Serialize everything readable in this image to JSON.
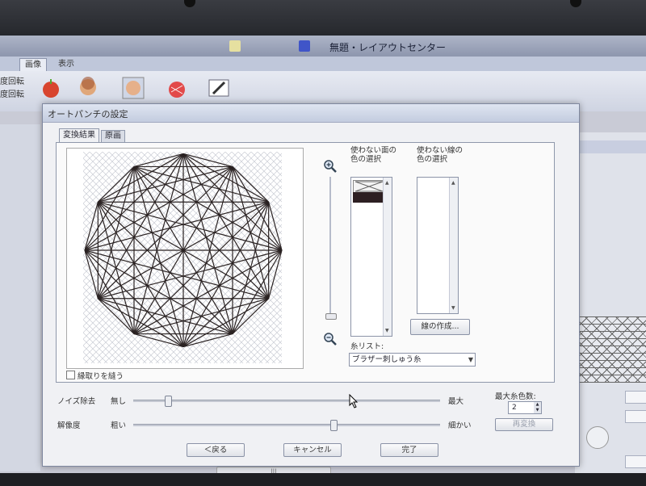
{
  "window": {
    "title": "無題・レイアウトセンター"
  },
  "ribbon": {
    "tabs": [
      "画像",
      "表示"
    ],
    "left_labels": [
      "度回転",
      "度回転"
    ],
    "icons": [
      "apple-icon",
      "child-photo-icon",
      "girl-photo-icon",
      "strawberry-icon",
      "pen-edit-icon"
    ]
  },
  "dialog": {
    "title": "オートパンチの設定",
    "tabs": [
      "変換結果",
      "原画"
    ],
    "unused_face_color_label": "使わない面の\n色の選択",
    "unused_line_color_label": "使わない線の\n色の選択",
    "make_line_button": "線の作成...",
    "thread_list_label": "糸リスト:",
    "thread_list_value": "ブラザー刺しゅう糸",
    "border_checkbox_label": "縁取りを縫う",
    "noise": {
      "label": "ノイズ除去",
      "min_label": "無し",
      "max_label": "最大",
      "value_fraction": 0.11
    },
    "resolution": {
      "label": "解像度",
      "min_label": "粗い",
      "max_label": "細かい",
      "value_fraction": 0.65
    },
    "max_colors_label": "最大糸色数:",
    "max_colors_value": "2",
    "reconvert_button": "再変換",
    "back_button": "＜戻る",
    "cancel_button": "キャンセル",
    "finish_button": "完了",
    "zoom_level_fraction": 0.02
  },
  "colors": {
    "dialog_bg": "#f0f1f4",
    "swatch_dark": "#2d1f22"
  }
}
